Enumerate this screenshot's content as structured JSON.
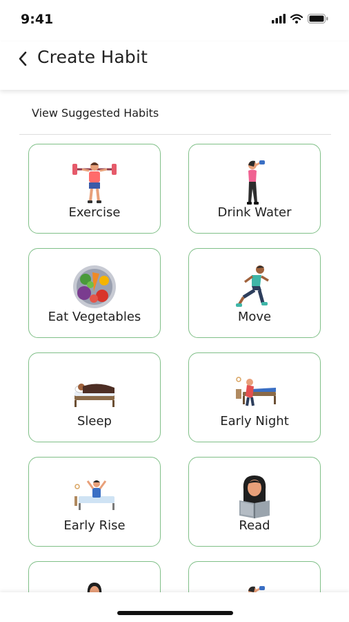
{
  "status_bar": {
    "time": "9:41"
  },
  "header": {
    "title": "Create Habit"
  },
  "section": {
    "label": "View Suggested Habits"
  },
  "habits": [
    {
      "label": "Exercise",
      "icon": "weightlifter-icon"
    },
    {
      "label": "Drink Water",
      "icon": "woman-drinking-water-icon"
    },
    {
      "label": "Eat Vegetables",
      "icon": "vegetable-plate-icon"
    },
    {
      "label": "Move",
      "icon": "runner-icon"
    },
    {
      "label": "Sleep",
      "icon": "person-sleeping-icon"
    },
    {
      "label": "Early Night",
      "icon": "person-going-to-bed-icon"
    },
    {
      "label": "Early Rise",
      "icon": "person-waking-up-icon"
    },
    {
      "label": "Read",
      "icon": "woman-reading-icon"
    }
  ],
  "colors": {
    "card_border": "#7fbf87",
    "text": "#222222"
  }
}
